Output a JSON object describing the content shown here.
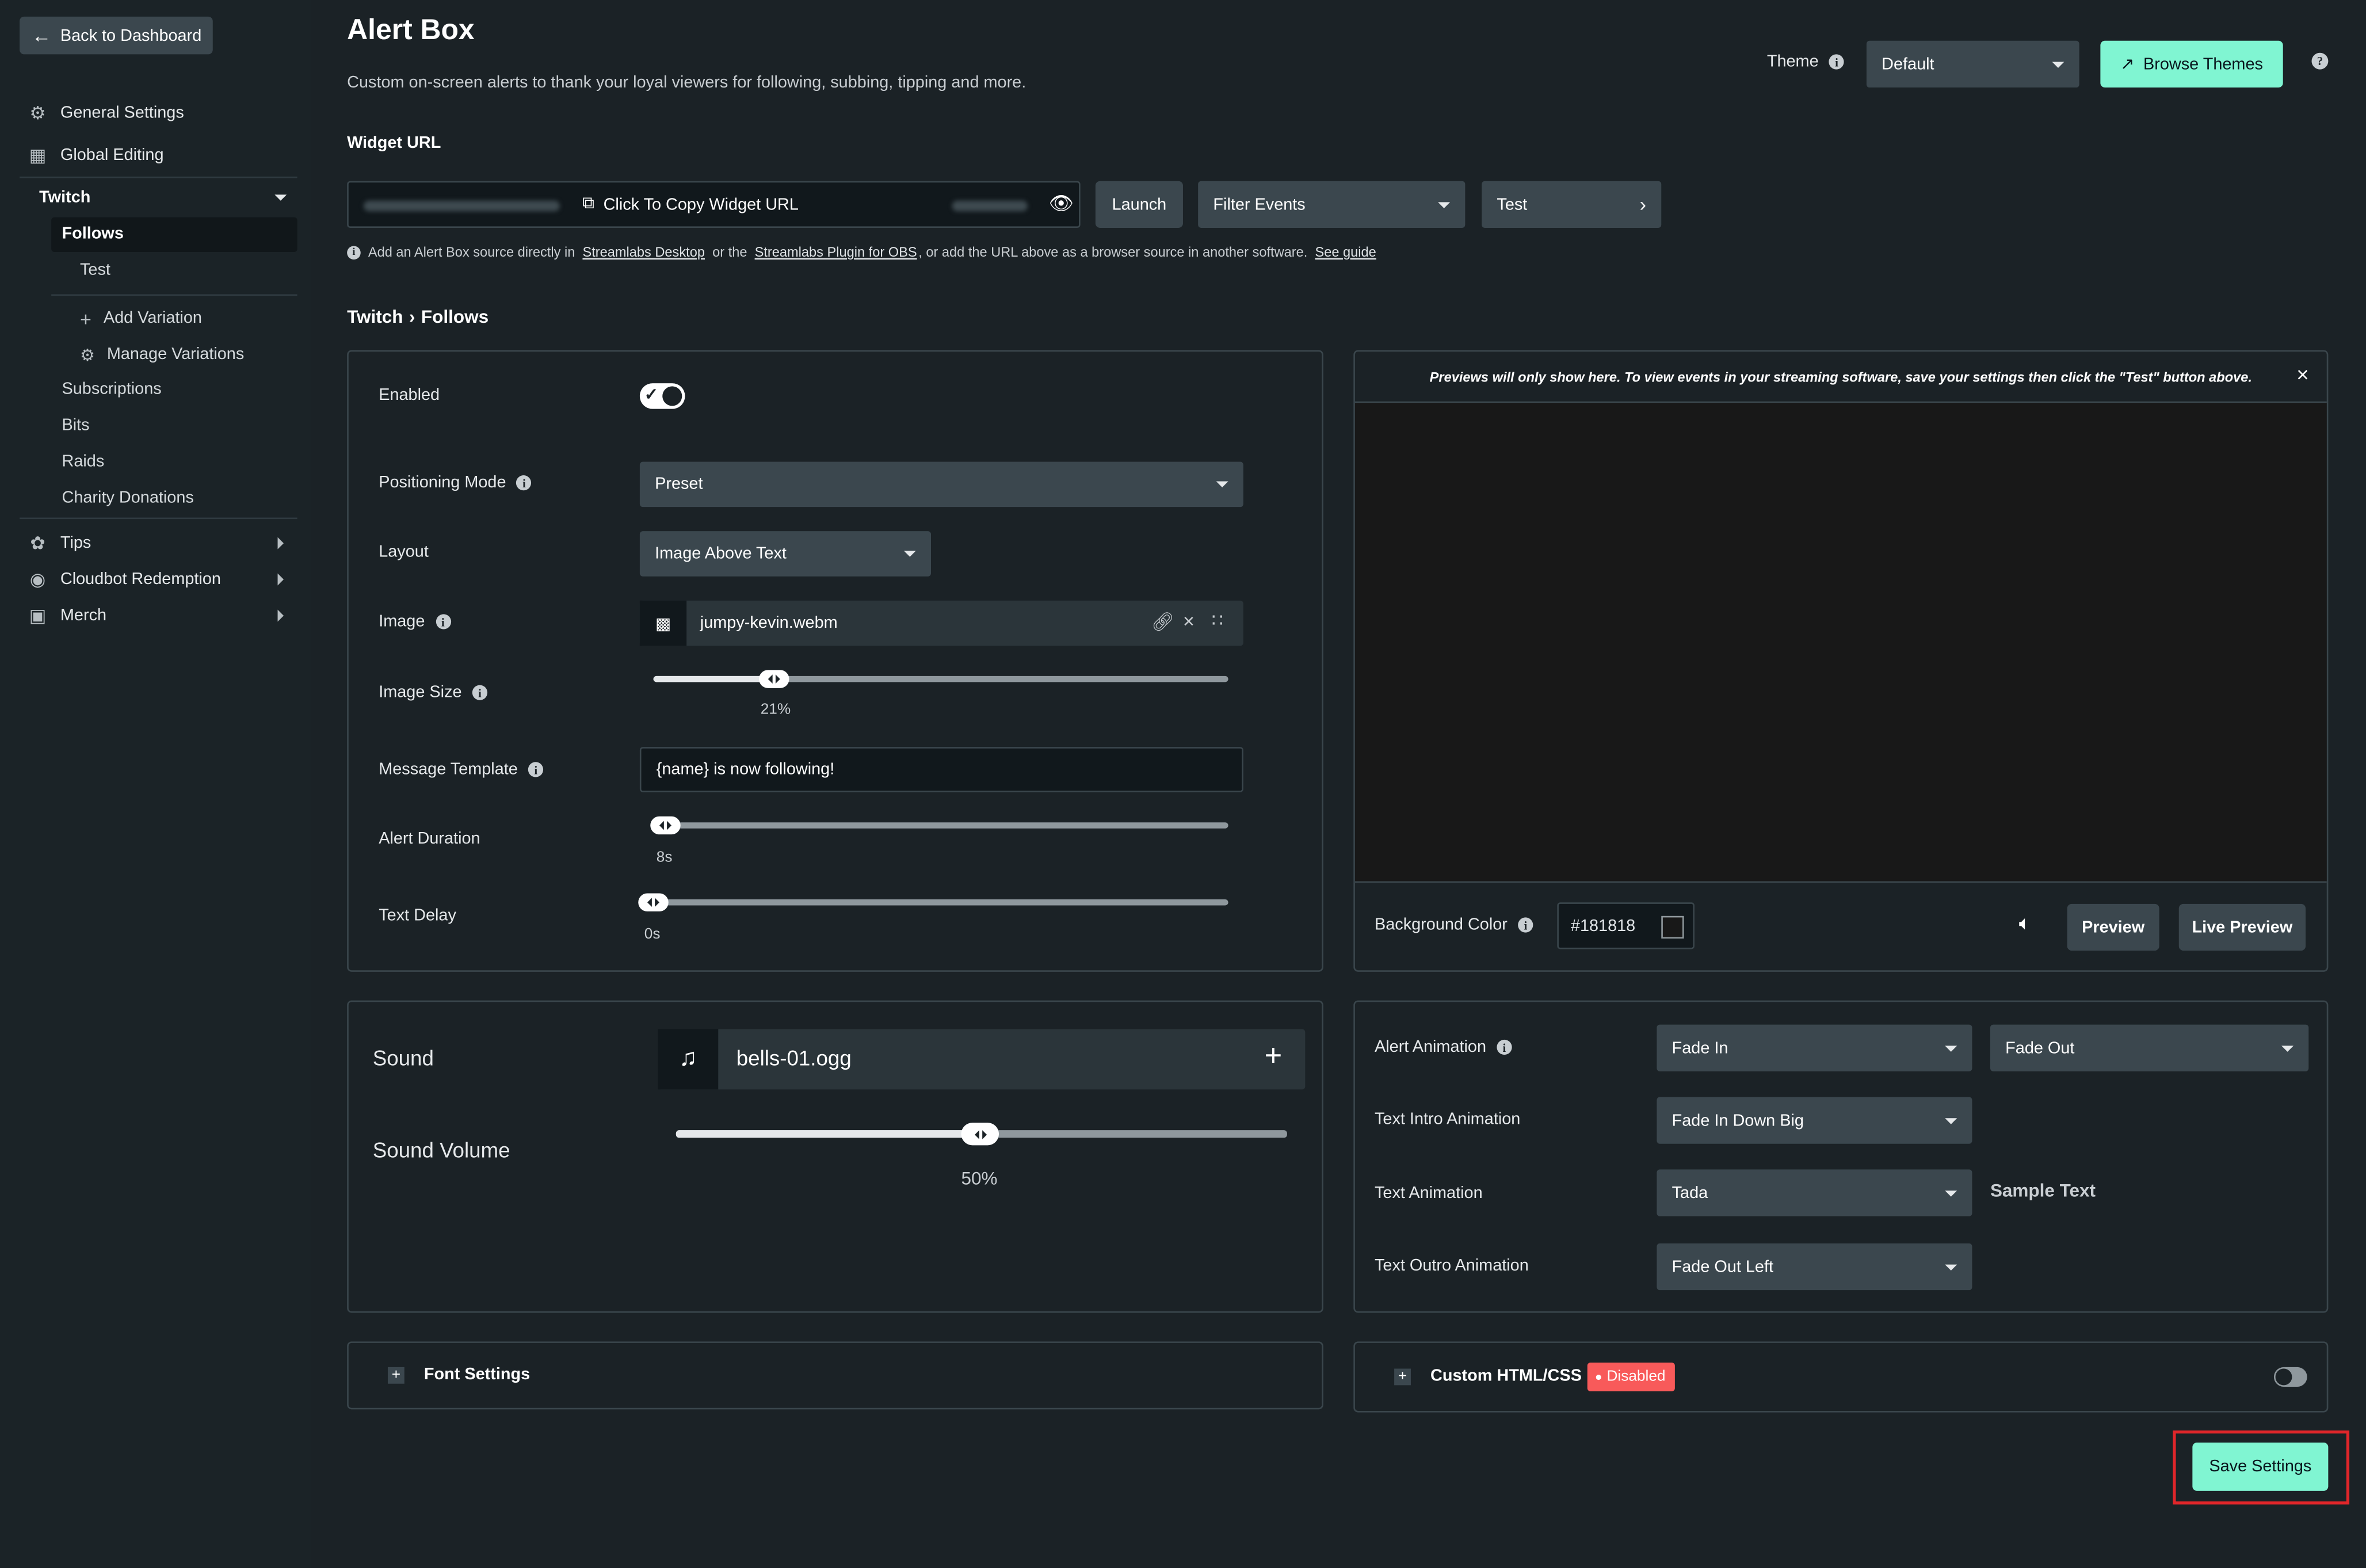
{
  "sidebar": {
    "back_label": "Back to Dashboard",
    "general_settings": "General Settings",
    "global_editing": "Global Editing",
    "twitch": "Twitch",
    "follows": "Follows",
    "test": "Test",
    "add_variation": "Add Variation",
    "manage_variations": "Manage Variations",
    "subscriptions": "Subscriptions",
    "bits": "Bits",
    "raids": "Raids",
    "charity_donations": "Charity Donations",
    "tips": "Tips",
    "cloudbot_redemption": "Cloudbot Redemption",
    "merch": "Merch"
  },
  "header": {
    "title": "Alert Box",
    "subtitle": "Custom on-screen alerts to thank your loyal viewers for following, subbing, tipping and more.",
    "theme_label": "Theme",
    "theme_value": "Default",
    "browse_themes": "Browse Themes"
  },
  "widget": {
    "label": "Widget URL",
    "copy_label": "Click To Copy Widget URL",
    "launch": "Launch",
    "filter_events": "Filter Events",
    "test": "Test",
    "help_1": "Add an Alert Box source directly in",
    "help_link_1": "Streamlabs Desktop",
    "help_2": "or the",
    "help_link_2": "Streamlabs Plugin for OBS",
    "help_3": ", or add the URL above as a browser source in another software.",
    "help_link_3": "See guide"
  },
  "breadcrumb": {
    "part1": "Twitch",
    "sep": "›",
    "part2": "Follows"
  },
  "settings": {
    "enabled_label": "Enabled",
    "enabled": true,
    "positioning_label": "Positioning Mode",
    "positioning_value": "Preset",
    "layout_label": "Layout",
    "layout_value": "Image Above Text",
    "image_label": "Image",
    "image_file": "jumpy-kevin.webm",
    "image_size_label": "Image Size",
    "image_size_value": "21%",
    "image_size_fraction": 0.21,
    "message_template_label": "Message Template",
    "message_template_value": "{name} is now following!",
    "alert_duration_label": "Alert Duration",
    "alert_duration_value": "8s",
    "text_delay_label": "Text Delay",
    "text_delay_value": "0s"
  },
  "preview": {
    "notice": "Previews will only show here. To view events in your streaming software, save your settings then click the \"Test\" button above.",
    "bg_color_label": "Background Color",
    "bg_color_value": "#181818",
    "preview_btn": "Preview",
    "live_preview_btn": "Live Preview"
  },
  "sound": {
    "label": "Sound",
    "file": "bells-01.ogg",
    "volume_label": "Sound Volume",
    "volume_value": "50%",
    "volume_fraction": 0.5
  },
  "animation": {
    "alert_label": "Alert Animation",
    "alert_in": "Fade In",
    "alert_out": "Fade Out",
    "text_intro_label": "Text Intro Animation",
    "text_intro_value": "Fade In Down Big",
    "text_anim_label": "Text Animation",
    "text_anim_value": "Tada",
    "sample_text": "Sample Text",
    "text_outro_label": "Text Outro Animation",
    "text_outro_value": "Fade Out Left"
  },
  "font_settings": {
    "label": "Font Settings"
  },
  "custom_html": {
    "label": "Custom HTML/CSS",
    "status": "Disabled"
  },
  "save_button": "Save Settings",
  "colors": {
    "accent": "#80f5d2",
    "danger": "#f85a5a",
    "highlight_outline": "#e0262a"
  }
}
